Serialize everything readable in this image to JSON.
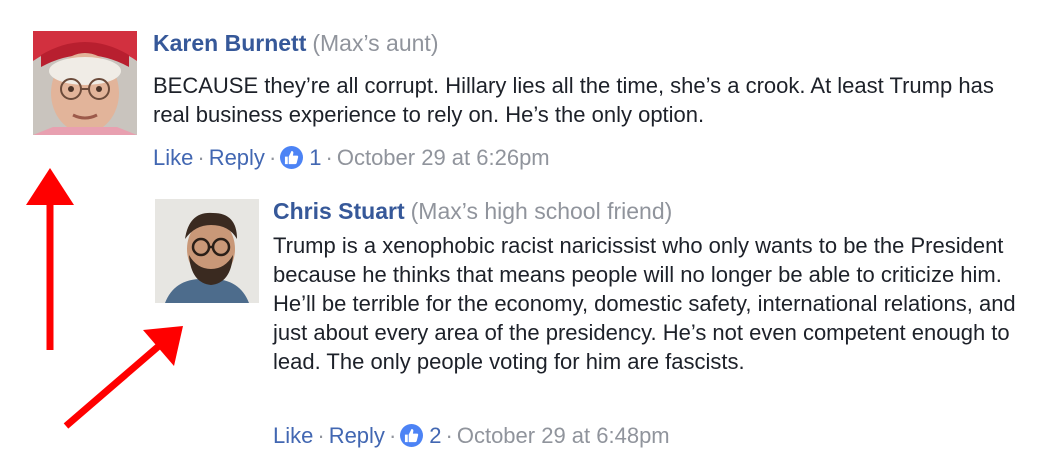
{
  "comments": [
    {
      "author": "Karen Burnett",
      "relation": "(Max’s aunt)",
      "text": "BECAUSE they’re all corrupt. Hillary lies all the time, she’s a crook. At least Trump has real business experience to rely on. He’s the only option.",
      "like_label": "Like",
      "reply_label": "Reply",
      "separator": "·",
      "like_count": "1",
      "timestamp": "October 29 at 6:26pm",
      "avatar_icon": "elderly-woman-photo"
    },
    {
      "author": "Chris Stuart",
      "relation": "(Max’s high school friend)",
      "text": "Trump is a xenophobic racist naricissist who only wants to be the President because he thinks that means people will no longer be able to criticize him. He’ll be terrible for the economy, domestic safety, international relations, and just about every area of the presidency. He’s not even competent enough to lead. The only people voting for him are fascists.",
      "like_label": "Like",
      "reply_label": "Reply",
      "separator": "·",
      "like_count": "2",
      "timestamp": "October 29 at 6:48pm",
      "avatar_icon": "bearded-man-photo"
    }
  ],
  "colors": {
    "author": "#365899",
    "link": "#4267b2",
    "meta": "#90949c",
    "text": "#1d2129",
    "like_badge": "#4c83f5",
    "arrow": "#ff0000"
  }
}
